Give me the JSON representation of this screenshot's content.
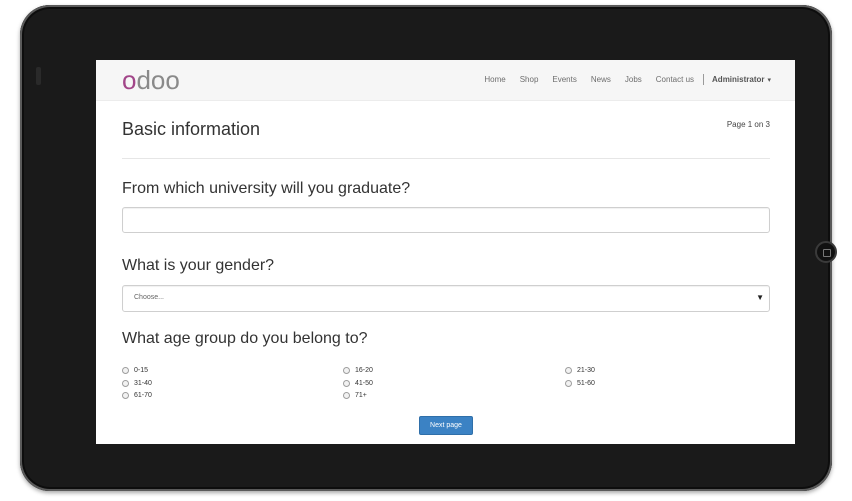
{
  "navbar": {
    "logo": {
      "first": "o",
      "rest": "doo"
    },
    "items": [
      "Home",
      "Shop",
      "Events",
      "News",
      "Jobs",
      "Contact us"
    ],
    "user": "Administrator",
    "user_caret": "▾"
  },
  "survey": {
    "title": "Basic information",
    "page_info": "Page 1 on 3",
    "questions": [
      {
        "label": "From which university will you graduate?",
        "value": ""
      },
      {
        "label": "What is your gender?",
        "selected": "Choose..."
      },
      {
        "label": "What age group do you belong to?",
        "options": [
          "0-15",
          "16-20",
          "21-30",
          "31-40",
          "41-50",
          "51-60",
          "61-70",
          "71+"
        ]
      }
    ],
    "select_arrow": "▼",
    "next_button": "Next page"
  },
  "colors": {
    "logo_accent": "#a24689",
    "logo_gray": "#8a8a8a",
    "button": "#3b82c4"
  }
}
